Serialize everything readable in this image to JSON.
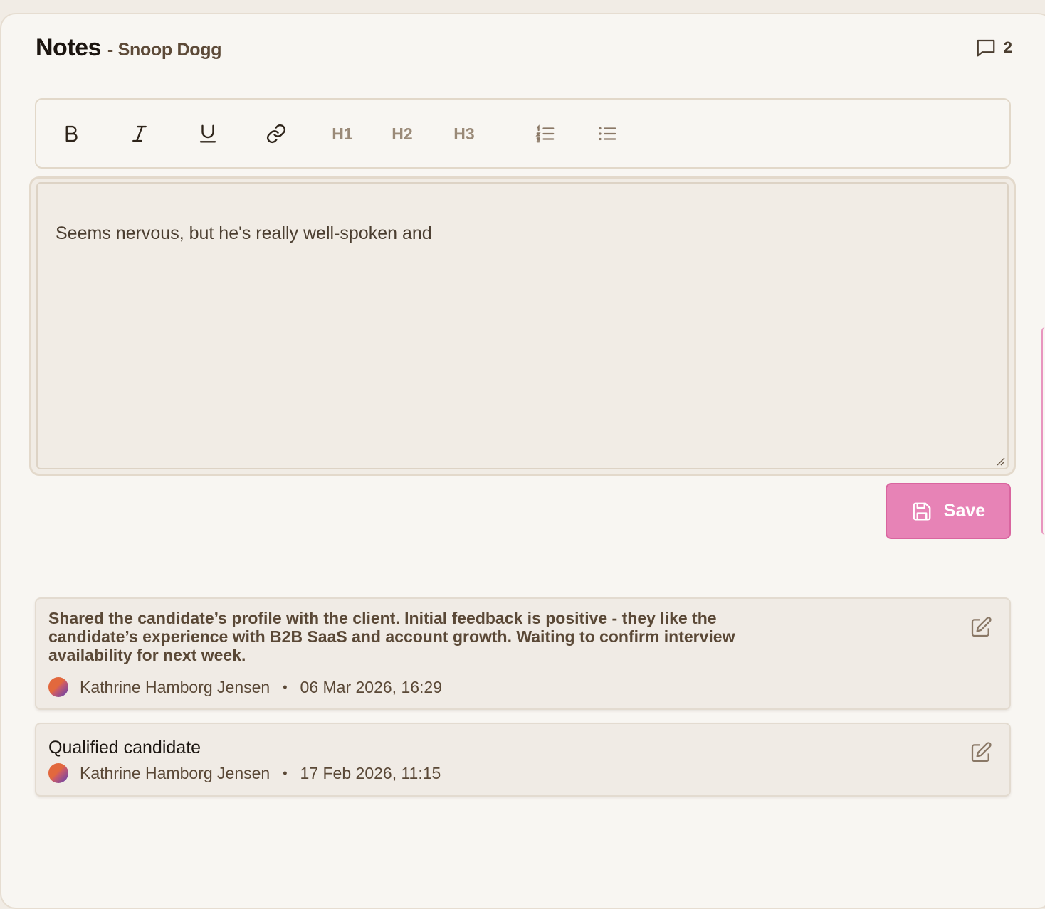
{
  "header": {
    "title": "Notes",
    "subtitle": "- Snoop Dogg",
    "comment_count": "2"
  },
  "toolbar": {
    "h1": "H1",
    "h2": "H2",
    "h3": "H3"
  },
  "editor": {
    "value": "Seems nervous, but he's really well-spoken and"
  },
  "save_button": {
    "label": "Save"
  },
  "notes": [
    {
      "text": "Shared the candidate’s profile with the client. Initial feedback is positive - they like the candidate’s experience with B2B SaaS and account growth. Waiting to confirm interview availability for next week.",
      "author": "Kathrine Hamborg Jensen",
      "separator": "•",
      "timestamp": "06 Mar 2026, 16:29"
    },
    {
      "text": "Qualified candidate",
      "author": "Kathrine Hamborg Jensen",
      "separator": "•",
      "timestamp": "17 Feb 2026, 11:15"
    }
  ],
  "colors": {
    "accent": "#e783b6",
    "background": "#f8f6f2",
    "editor_bg": "#f1ece5"
  }
}
